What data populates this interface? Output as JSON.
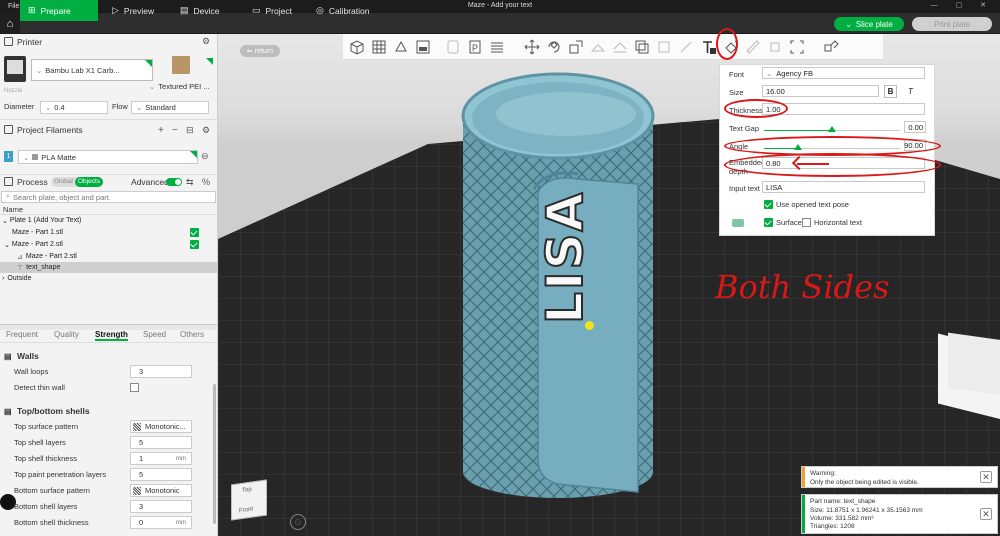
{
  "window": {
    "file_menu": "File",
    "title": "Maze - Add your text",
    "controls": "— ▢ ✕"
  },
  "tabs": [
    {
      "label": "Prepare",
      "icon": "plus-square-icon",
      "active": true
    },
    {
      "label": "Preview",
      "icon": "play-icon",
      "active": false
    },
    {
      "label": "Device",
      "icon": "device-icon",
      "active": false
    },
    {
      "label": "Project",
      "icon": "project-icon",
      "active": false
    },
    {
      "label": "Calibration",
      "icon": "calibration-icon",
      "active": false
    }
  ],
  "actions": {
    "slice": "Slice plate",
    "print": "Print plate"
  },
  "printer": {
    "heading": "Printer",
    "name": "Bambu Lab X1 Carb...",
    "plate": "Textured PEI ...",
    "nozzle_label": "Nozzle",
    "diameter_label": "Diameter",
    "diameter_value": "0.4",
    "flow_label": "Flow",
    "flow_value": "Standard"
  },
  "filaments": {
    "heading": "Project Filaments",
    "items": [
      {
        "index": "1",
        "name": "PLA Matte",
        "color": "#00ae42"
      }
    ]
  },
  "process": {
    "heading": "Process",
    "toggle_global": "Global",
    "toggle_objects": "Objects",
    "advanced_label": "Advanced",
    "search_placeholder": "Search plate, object and part.",
    "col_name": "Name",
    "tree": [
      {
        "label": "Plate 1 (Add Your Text)",
        "level": 0,
        "arrow": "⌄"
      },
      {
        "label": "Maze - Part 1.stl",
        "level": 1,
        "checked": true
      },
      {
        "label": "Maze - Part 2.stl",
        "level": 1,
        "checked": true,
        "arrow": "⌄"
      },
      {
        "label": "Maze - Part 2.stl",
        "level": 2
      },
      {
        "label": "text_shape",
        "level": 2,
        "selected": true
      },
      {
        "label": "Outside",
        "level": 0,
        "arrow": "›"
      }
    ]
  },
  "settings_tabs": [
    "Frequent",
    "Quality",
    "Strength",
    "Speed",
    "Others"
  ],
  "settings_active": "Strength",
  "walls": {
    "heading": "Walls",
    "wall_loops_label": "Wall loops",
    "wall_loops_value": "3",
    "detect_thin_label": "Detect thin wall"
  },
  "topbottom": {
    "heading": "Top/bottom shells",
    "rows": [
      {
        "label": "Top surface pattern",
        "value": "Monotonic...",
        "unit": ""
      },
      {
        "label": "Top shell layers",
        "value": "5",
        "unit": ""
      },
      {
        "label": "Top shell thickness",
        "value": "1",
        "unit": "mm"
      },
      {
        "label": "Top paint penetration layers",
        "value": "5",
        "unit": ""
      },
      {
        "label": "Bottom surface pattern",
        "value": "Monotonic",
        "unit": ""
      },
      {
        "label": "Bottom shell layers",
        "value": "3",
        "unit": ""
      },
      {
        "label": "Bottom shell thickness",
        "value": "0",
        "unit": "mm"
      }
    ]
  },
  "viewport": {
    "return_label": "return",
    "view_cube_top": "Top",
    "view_cube_front": "Front",
    "model_text": "LISA",
    "annotation": "Both Sides"
  },
  "text_tool": {
    "font_label": "Font",
    "font_value": "Agency FB",
    "size_label": "Size",
    "size_value": "16.00",
    "bold": "B",
    "italic": "T",
    "thickness_label": "Thickness",
    "thickness_value": "1.00",
    "textgap_label": "Text Gap",
    "textgap_value": "0.00",
    "textgap_fraction": 0.5,
    "angle_label": "Angle",
    "angle_value": "90.00",
    "angle_fraction": 0.25,
    "embedded_label_1": "Embedded",
    "embedded_label_2": "depth",
    "embedded_value": "0.80",
    "input_label": "Input text",
    "input_value": "LISA",
    "use_opened_label": "Use opened text pose",
    "surface_label": "Surface",
    "horizontal_label": "Horizontal text"
  },
  "notifications": {
    "warning_title": "Warning:",
    "warning_body": "Only the object being edited is visible.",
    "part_name": "Part name: text_shape",
    "size": "Size: 11.8751 x 1.96241 x 35.1563 mm",
    "volume": "Volume: 331.582 mm³",
    "triangles": "Triangles: 1208"
  },
  "colors": {
    "accent": "#00ae42",
    "model": "#6b9fae",
    "annotation": "#d91818"
  }
}
